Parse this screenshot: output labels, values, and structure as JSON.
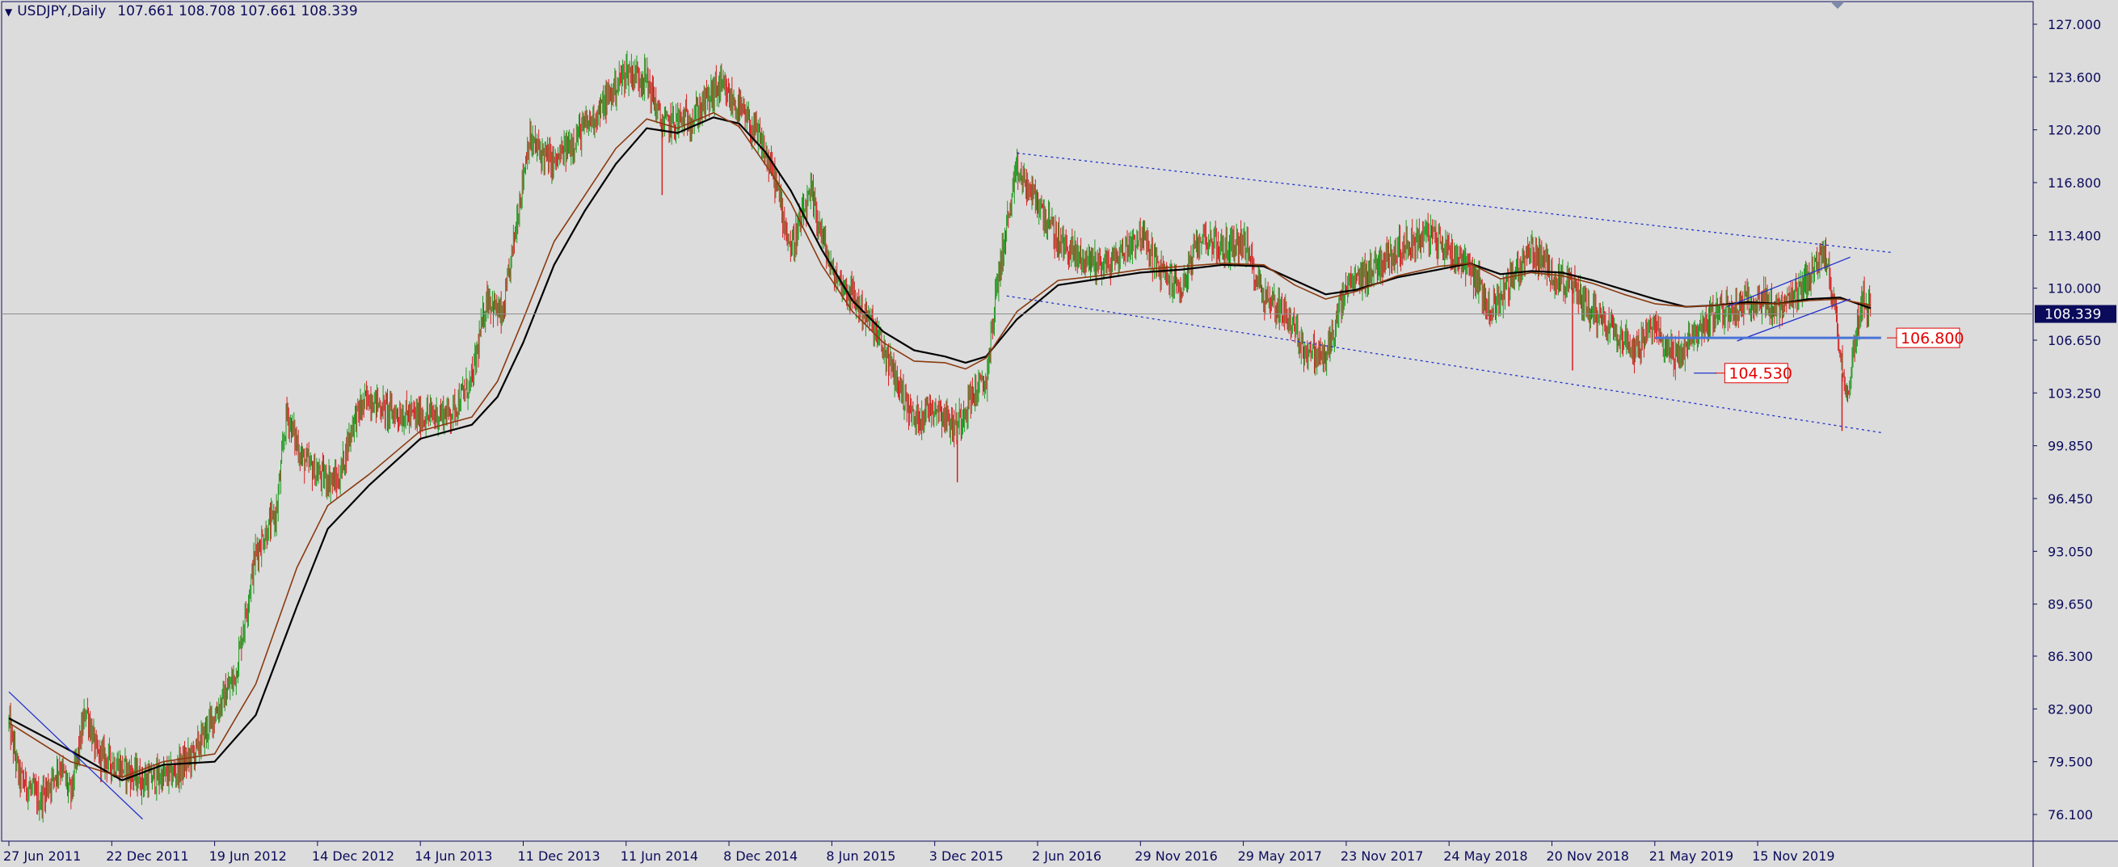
{
  "header": {
    "symbol": "USDJPY,Daily",
    "ohlc": "107.661 108.708 107.661 108.339"
  },
  "colors": {
    "background": "#dcdcdc",
    "axis": "#0b0b5c",
    "bull_candle": "#1f9a1f",
    "bear_candle": "#d41f1f",
    "ma_fast": "#8a3a10",
    "ma_slow": "#000000",
    "trendline": "#2233cc",
    "level_label": "#e30000",
    "current_price_badge": "#0b0b5c",
    "current_price_line": "#8c8c8c"
  },
  "chart_data": {
    "type": "candlestick",
    "symbol": "USDJPY",
    "timeframe": "Daily",
    "last_ohlc": {
      "open": 107.661,
      "high": 108.708,
      "low": 107.661,
      "close": 108.339
    },
    "ylim": [
      74.5,
      128.7
    ],
    "y_ticks": [
      "127.000",
      "123.600",
      "120.200",
      "116.800",
      "113.400",
      "110.000",
      "106.650",
      "103.250",
      "99.850",
      "96.450",
      "93.050",
      "89.650",
      "86.300",
      "82.900",
      "79.500",
      "76.100"
    ],
    "x_tick_labels": [
      "27 Jun 2011",
      "22 Dec 2011",
      "19 Jun 2012",
      "14 Dec 2012",
      "14 Jun 2013",
      "11 Dec 2013",
      "11 Jun 2014",
      "8 Dec 2014",
      "8 Jun 2015",
      "3 Dec 2015",
      "2 Jun 2016",
      "29 Nov 2016",
      "29 May 2017",
      "23 Nov 2017",
      "24 May 2018",
      "20 Nov 2018",
      "21 May 2019",
      "15 Nov 2019"
    ],
    "price_path": [
      [
        0,
        82.0
      ],
      [
        0.1,
        78.5
      ],
      [
        0.3,
        77.0
      ],
      [
        0.5,
        79.3
      ],
      [
        0.6,
        77.3
      ],
      [
        0.75,
        83.0
      ],
      [
        0.85,
        80.0
      ],
      [
        1.0,
        79.5
      ],
      [
        1.3,
        78.3
      ],
      [
        1.6,
        78.7
      ],
      [
        1.8,
        80.0
      ],
      [
        2.0,
        82.5
      ],
      [
        2.2,
        85.0
      ],
      [
        2.4,
        93.0
      ],
      [
        2.6,
        95.5
      ],
      [
        2.7,
        102.0
      ],
      [
        2.85,
        99.0
      ],
      [
        3.0,
        98.0
      ],
      [
        3.2,
        97.5
      ],
      [
        3.35,
        101.5
      ],
      [
        3.5,
        103.0
      ],
      [
        3.7,
        102.0
      ],
      [
        4.0,
        101.7
      ],
      [
        4.3,
        102.0
      ],
      [
        4.5,
        104.0
      ],
      [
        4.65,
        109.5
      ],
      [
        4.8,
        108.0
      ],
      [
        4.95,
        115.0
      ],
      [
        5.05,
        119.5
      ],
      [
        5.3,
        118.0
      ],
      [
        5.55,
        120.0
      ],
      [
        5.75,
        121.5
      ],
      [
        6.0,
        124.0
      ],
      [
        6.2,
        123.5
      ],
      [
        6.35,
        120.5
      ],
      [
        6.65,
        121.0
      ],
      [
        6.9,
        123.0
      ],
      [
        7.1,
        121.5
      ],
      [
        7.3,
        119.5
      ],
      [
        7.45,
        117.0
      ],
      [
        7.6,
        112.5
      ],
      [
        7.8,
        116.0
      ],
      [
        8.0,
        111.0
      ],
      [
        8.2,
        109.5
      ],
      [
        8.4,
        107.5
      ],
      [
        8.6,
        104.5
      ],
      [
        8.8,
        101.5
      ],
      [
        9.0,
        102.5
      ],
      [
        9.2,
        101.0
      ],
      [
        9.35,
        103.0
      ],
      [
        9.5,
        104.0
      ],
      [
        9.6,
        110.0
      ],
      [
        9.7,
        114.0
      ],
      [
        9.8,
        117.5
      ],
      [
        10.0,
        115.5
      ],
      [
        10.2,
        113.0
      ],
      [
        10.4,
        112.0
      ],
      [
        10.7,
        111.5
      ],
      [
        11.0,
        113.5
      ],
      [
        11.2,
        111.0
      ],
      [
        11.4,
        110.0
      ],
      [
        11.6,
        113.5
      ],
      [
        11.8,
        112.5
      ],
      [
        12.0,
        113.0
      ],
      [
        12.2,
        109.5
      ],
      [
        12.4,
        108.5
      ],
      [
        12.6,
        106.0
      ],
      [
        12.8,
        105.5
      ],
      [
        13.0,
        110.0
      ],
      [
        13.2,
        111.0
      ],
      [
        13.5,
        112.5
      ],
      [
        13.8,
        113.5
      ],
      [
        14.0,
        112.5
      ],
      [
        14.2,
        111.5
      ],
      [
        14.4,
        108.5
      ],
      [
        14.6,
        110.5
      ],
      [
        14.8,
        112.5
      ],
      [
        15.0,
        111.0
      ],
      [
        15.2,
        110.0
      ],
      [
        15.4,
        108.5
      ],
      [
        15.6,
        107.5
      ],
      [
        15.8,
        106.0
      ],
      [
        16.0,
        107.5
      ],
      [
        16.2,
        105.5
      ],
      [
        16.4,
        107.0
      ],
      [
        16.6,
        108.5
      ],
      [
        16.8,
        108.7
      ],
      [
        17.0,
        109.5
      ],
      [
        17.2,
        108.5
      ],
      [
        17.4,
        109.5
      ],
      [
        17.55,
        111.5
      ],
      [
        17.65,
        112.0
      ],
      [
        17.75,
        109.0
      ],
      [
        17.82,
        105.0
      ],
      [
        17.88,
        102.5
      ],
      [
        17.93,
        106.0
      ],
      [
        18.02,
        109.5
      ],
      [
        18.1,
        108.3
      ]
    ],
    "sma_fast_path": [
      [
        0,
        82.0
      ],
      [
        0.6,
        79.5
      ],
      [
        1.1,
        78.5
      ],
      [
        1.5,
        79.5
      ],
      [
        2.0,
        80.0
      ],
      [
        2.4,
        84.5
      ],
      [
        2.8,
        92.0
      ],
      [
        3.1,
        96.0
      ],
      [
        3.5,
        98.0
      ],
      [
        4.0,
        100.8
      ],
      [
        4.5,
        101.7
      ],
      [
        4.75,
        104.0
      ],
      [
        5.0,
        108.0
      ],
      [
        5.3,
        113.0
      ],
      [
        5.6,
        116.0
      ],
      [
        5.9,
        119.0
      ],
      [
        6.2,
        120.9
      ],
      [
        6.5,
        120.3
      ],
      [
        6.85,
        121.3
      ],
      [
        7.1,
        120.4
      ],
      [
        7.35,
        118.0
      ],
      [
        7.6,
        115.5
      ],
      [
        7.9,
        111.5
      ],
      [
        8.2,
        108.5
      ],
      [
        8.5,
        106.5
      ],
      [
        8.8,
        105.3
      ],
      [
        9.1,
        105.2
      ],
      [
        9.3,
        104.8
      ],
      [
        9.5,
        105.5
      ],
      [
        9.8,
        108.5
      ],
      [
        10.2,
        110.5
      ],
      [
        10.6,
        110.8
      ],
      [
        11.0,
        111.2
      ],
      [
        11.4,
        111.4
      ],
      [
        11.8,
        111.6
      ],
      [
        12.2,
        111.5
      ],
      [
        12.5,
        110.2
      ],
      [
        12.8,
        109.3
      ],
      [
        13.1,
        109.8
      ],
      [
        13.5,
        110.8
      ],
      [
        13.9,
        111.4
      ],
      [
        14.2,
        111.6
      ],
      [
        14.5,
        110.6
      ],
      [
        14.8,
        111.0
      ],
      [
        15.1,
        110.8
      ],
      [
        15.4,
        110.3
      ],
      [
        15.7,
        109.6
      ],
      [
        16.0,
        109.0
      ],
      [
        16.3,
        108.8
      ],
      [
        16.6,
        108.9
      ],
      [
        16.9,
        109.0
      ],
      [
        17.2,
        109.0
      ],
      [
        17.5,
        109.2
      ],
      [
        17.8,
        109.3
      ],
      [
        18.1,
        108.9
      ]
    ],
    "sma_slow_path": [
      [
        0,
        82.3
      ],
      [
        0.6,
        80.2
      ],
      [
        1.1,
        78.3
      ],
      [
        1.5,
        79.3
      ],
      [
        2.0,
        79.5
      ],
      [
        2.4,
        82.5
      ],
      [
        2.8,
        89.5
      ],
      [
        3.1,
        94.5
      ],
      [
        3.5,
        97.3
      ],
      [
        4.0,
        100.3
      ],
      [
        4.5,
        101.2
      ],
      [
        4.75,
        103.0
      ],
      [
        5.0,
        106.5
      ],
      [
        5.3,
        111.5
      ],
      [
        5.6,
        115.0
      ],
      [
        5.9,
        118.0
      ],
      [
        6.2,
        120.3
      ],
      [
        6.5,
        120.0
      ],
      [
        6.85,
        121.0
      ],
      [
        7.1,
        120.6
      ],
      [
        7.35,
        118.8
      ],
      [
        7.6,
        116.3
      ],
      [
        7.9,
        112.5
      ],
      [
        8.2,
        109.2
      ],
      [
        8.5,
        107.2
      ],
      [
        8.8,
        106.0
      ],
      [
        9.1,
        105.6
      ],
      [
        9.3,
        105.2
      ],
      [
        9.5,
        105.6
      ],
      [
        9.8,
        108.0
      ],
      [
        10.2,
        110.2
      ],
      [
        10.6,
        110.6
      ],
      [
        11.0,
        111.0
      ],
      [
        11.4,
        111.2
      ],
      [
        11.8,
        111.5
      ],
      [
        12.2,
        111.4
      ],
      [
        12.5,
        110.5
      ],
      [
        12.8,
        109.6
      ],
      [
        13.1,
        109.9
      ],
      [
        13.5,
        110.7
      ],
      [
        13.9,
        111.2
      ],
      [
        14.2,
        111.6
      ],
      [
        14.5,
        110.9
      ],
      [
        14.8,
        111.1
      ],
      [
        15.1,
        111.0
      ],
      [
        15.4,
        110.5
      ],
      [
        15.7,
        109.9
      ],
      [
        16.0,
        109.3
      ],
      [
        16.3,
        108.8
      ],
      [
        16.6,
        108.9
      ],
      [
        16.9,
        109.1
      ],
      [
        17.2,
        109.0
      ],
      [
        17.5,
        109.3
      ],
      [
        17.8,
        109.4
      ],
      [
        18.1,
        108.7
      ]
    ],
    "trendlines": [
      {
        "name": "early-downtrend",
        "x": [
          0.0,
          1.3
        ],
        "y": [
          84.0,
          75.8
        ],
        "style": "solid"
      },
      {
        "name": "channel-upper",
        "x": [
          9.8,
          18.3
        ],
        "y": [
          118.7,
          112.3
        ],
        "style": "dotted"
      },
      {
        "name": "channel-lower",
        "x": [
          9.7,
          18.2
        ],
        "y": [
          109.5,
          100.7
        ],
        "style": "dotted"
      },
      {
        "name": "rising-wedge-upper",
        "x": [
          16.7,
          17.9
        ],
        "y": [
          108.8,
          112.0
        ],
        "style": "solid"
      },
      {
        "name": "rising-wedge-lower",
        "x": [
          16.8,
          17.9
        ],
        "y": [
          106.6,
          109.3
        ],
        "style": "solid"
      },
      {
        "name": "support-106800",
        "x": [
          16.0,
          18.2
        ],
        "y": [
          106.8,
          106.8
        ],
        "style": "thick"
      },
      {
        "name": "low-104530",
        "x": [
          16.38,
          16.6
        ],
        "y": [
          104.53,
          104.53
        ],
        "style": "solid"
      }
    ],
    "levels": [
      {
        "label": "106.800",
        "value": 106.8,
        "x": 18.35
      },
      {
        "label": "104.530",
        "value": 104.53,
        "x": 16.68
      }
    ],
    "current_price": {
      "label": "108.339",
      "value": 108.339
    }
  }
}
